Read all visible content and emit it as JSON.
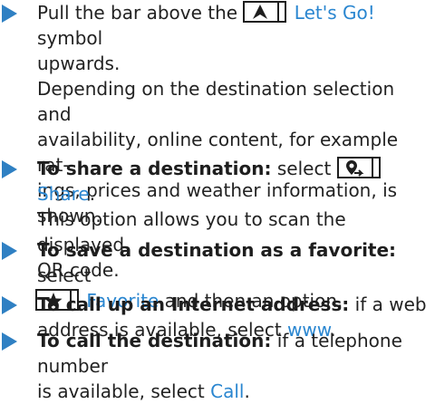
{
  "steps": [
    {
      "prefix": "Pull the bar above the",
      "symbol_label": "Let's Go!",
      "suffix": "symbol",
      "line2": "upwards.",
      "para": [
        "Depending on the destination selection and",
        "availability, online content, for example rat-",
        "ings, prices and weather information, is",
        "shown."
      ]
    },
    {
      "bold": "To share a destination:",
      "prefix": "select",
      "symbol_label": "Share",
      "suffix": ".",
      "lines": [
        "This option allows you to scan the displayed",
        "QR code."
      ]
    },
    {
      "bold": "To save a destination as a favorite:",
      "prefix": "select",
      "symbol_label": "Favorite",
      "suffix": "and then an option."
    },
    {
      "bold": "To call up an Internet address:",
      "prefix": "if a web",
      "line2_prefix": "address is available, select",
      "keyword": "www",
      "suffix": "."
    },
    {
      "bold": "To call the destination:",
      "prefix": "if a telephone number",
      "line2_prefix": "is available, select",
      "keyword": "Call",
      "suffix": "."
    }
  ],
  "icons": {
    "arrow": "bullet-arrow-icon",
    "lets_go": "navigation-arrow-icon",
    "share": "share-destination-icon",
    "favorite": "star-icon"
  },
  "colors": {
    "arrow": "#2f80c3",
    "keyword": "#2a86d0",
    "text": "#222222"
  }
}
